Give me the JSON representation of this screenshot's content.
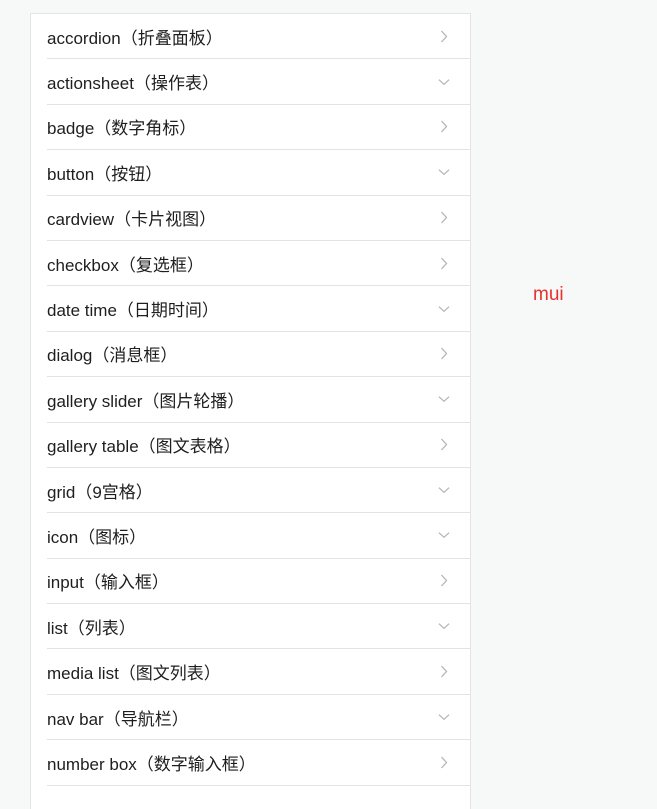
{
  "menu": {
    "items": [
      {
        "label": "accordion（折叠面板）",
        "icon": "chevron-right-icon"
      },
      {
        "label": "actionsheet（操作表）",
        "icon": "chevron-down-icon"
      },
      {
        "label": "badge（数字角标）",
        "icon": "chevron-right-icon"
      },
      {
        "label": "button（按钮）",
        "icon": "chevron-down-icon"
      },
      {
        "label": "cardview（卡片视图）",
        "icon": "chevron-right-icon"
      },
      {
        "label": "checkbox（复选框）",
        "icon": "chevron-right-icon"
      },
      {
        "label": "date time（日期时间）",
        "icon": "chevron-down-icon"
      },
      {
        "label": "dialog（消息框）",
        "icon": "chevron-right-icon"
      },
      {
        "label": "gallery slider（图片轮播）",
        "icon": "chevron-down-icon"
      },
      {
        "label": "gallery table（图文表格）",
        "icon": "chevron-right-icon"
      },
      {
        "label": "grid（9宫格）",
        "icon": "chevron-down-icon"
      },
      {
        "label": "icon（图标）",
        "icon": "chevron-down-icon"
      },
      {
        "label": "input（输入框）",
        "icon": "chevron-right-icon"
      },
      {
        "label": "list（列表）",
        "icon": "chevron-down-icon"
      },
      {
        "label": "media list（图文列表）",
        "icon": "chevron-right-icon"
      },
      {
        "label": "nav bar（导航栏）",
        "icon": "chevron-down-icon"
      },
      {
        "label": "number box（数字输入框）",
        "icon": "chevron-right-icon"
      }
    ]
  },
  "brand": {
    "text": "mui",
    "color": "#e8322c"
  },
  "colors": {
    "chevron": "#b5b5b5",
    "divider": "#e3e3e3",
    "text": "#1e1e1e"
  }
}
